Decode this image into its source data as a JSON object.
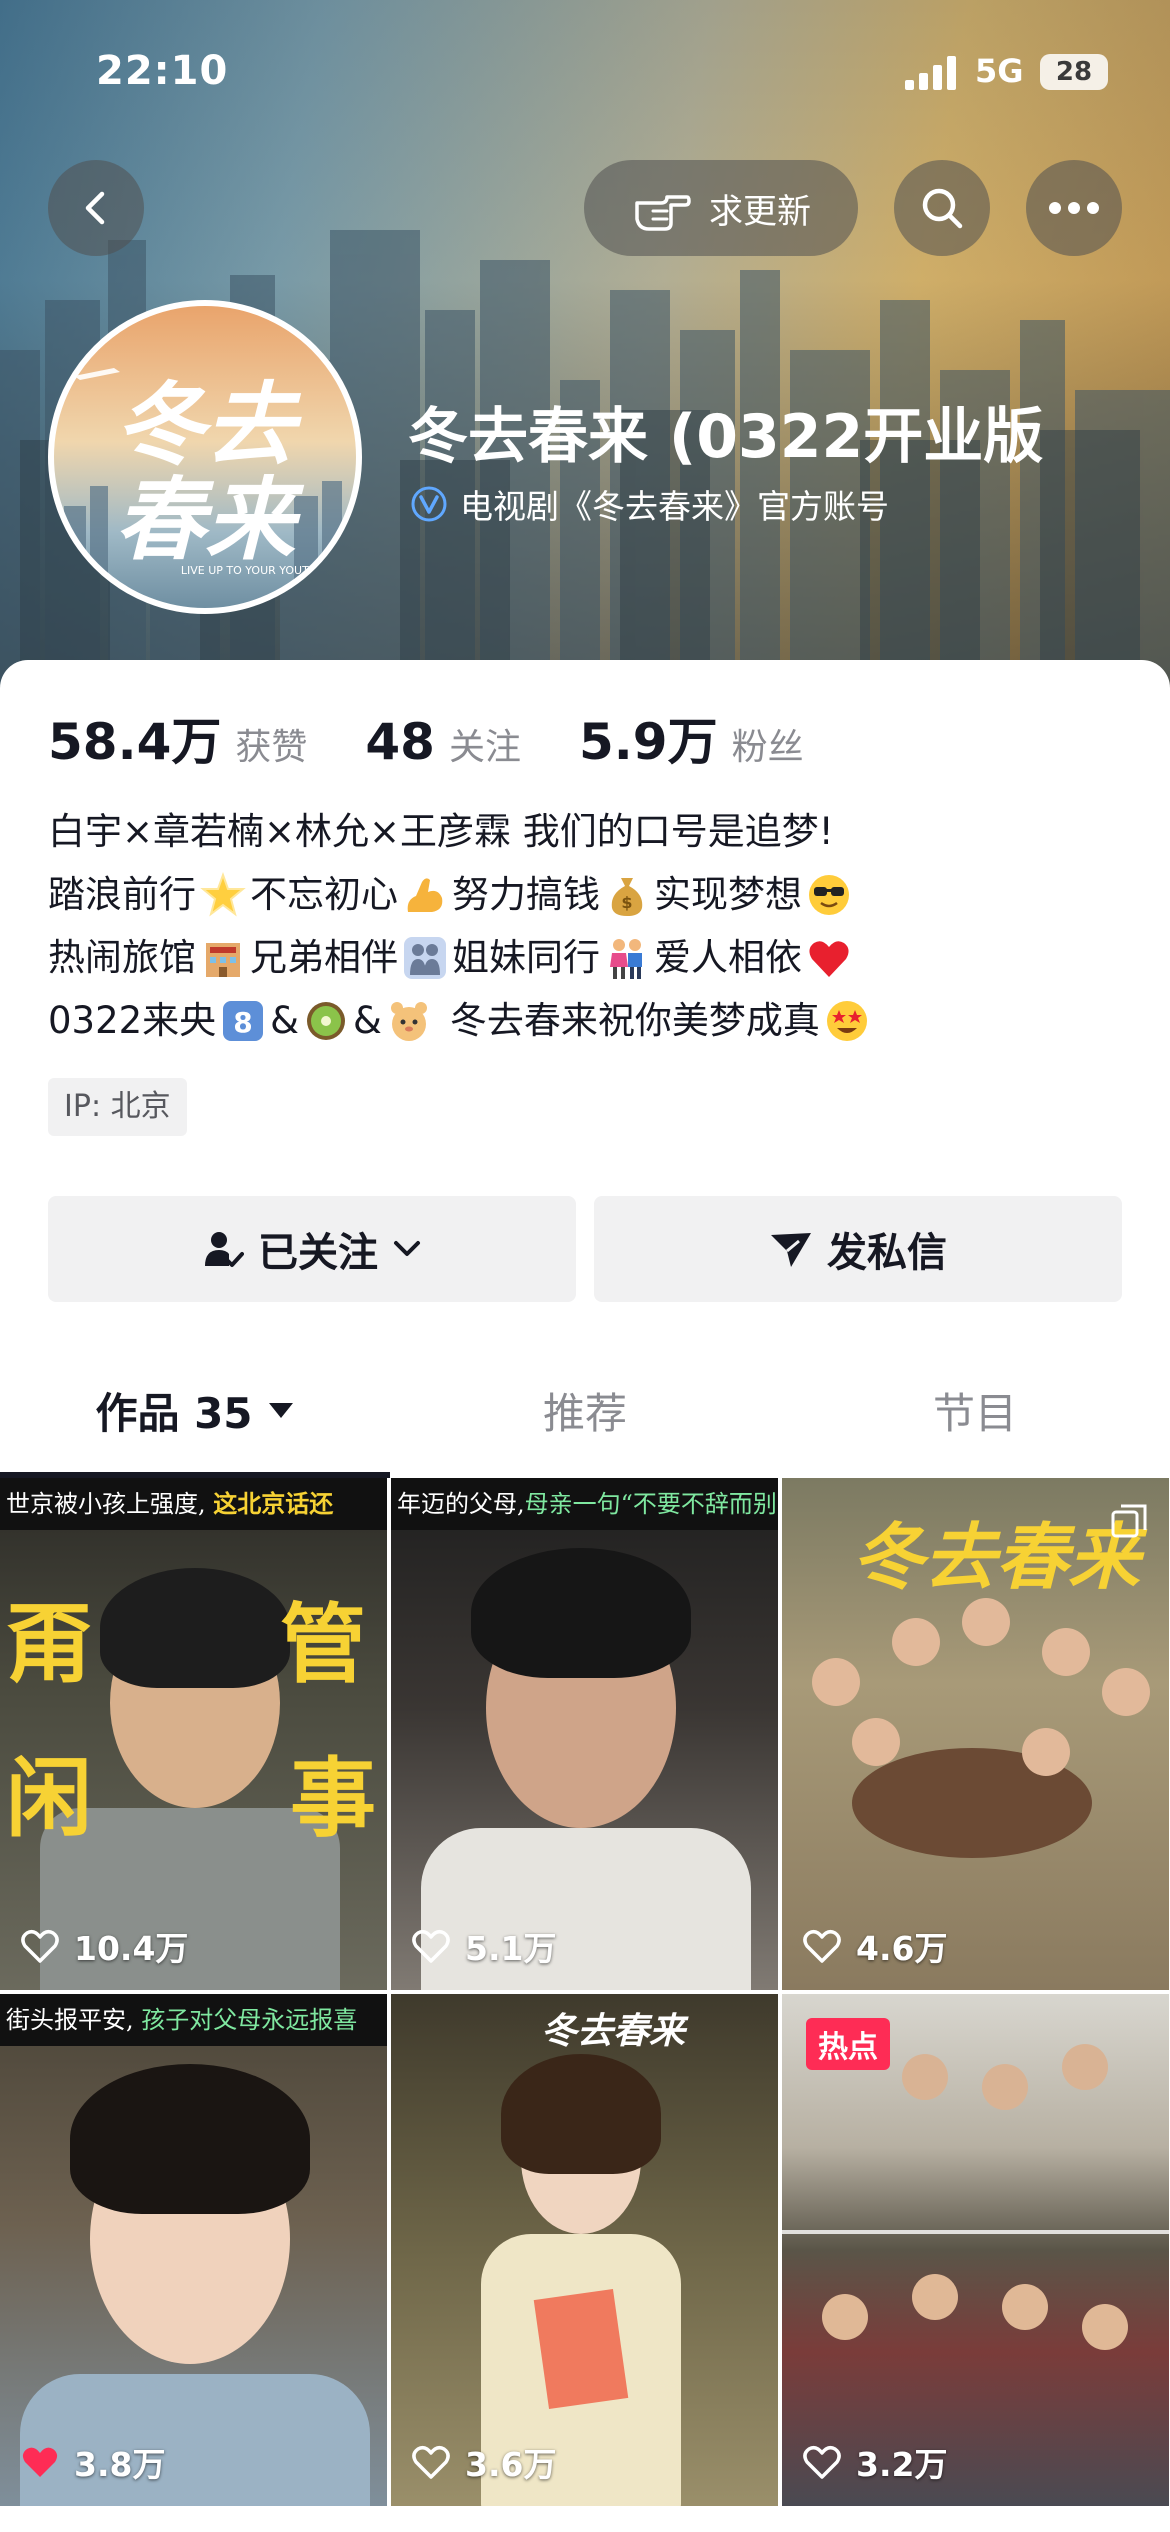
{
  "status_bar": {
    "time": "22:10",
    "network": "5G",
    "battery": "28"
  },
  "header": {
    "request_update_label": "求更新",
    "profile_name": "冬去春来 (0322开业版",
    "verification_text": "电视剧《冬去春来》官方账号",
    "avatar_title": "冬去春来",
    "avatar_subtitle": "LIVE UP TO YOUR YOUTH"
  },
  "stats": [
    {
      "value": "58.4万",
      "label": "获赞"
    },
    {
      "value": "48",
      "label": "关注"
    },
    {
      "value": "5.9万",
      "label": "粉丝"
    }
  ],
  "bio": {
    "line1": "白宇×章若楠×林允×王彦霖 我们的口号是追梦!",
    "line2_parts": [
      "踏浪前行",
      "不忘初心",
      "努力搞钱",
      "实现梦想"
    ],
    "line3_parts": [
      "热闹旅馆",
      "兄弟相伴",
      "姐妹同行",
      "爱人相依"
    ],
    "line4_prefix": "0322来央",
    "line4_amp": "&",
    "line4_suffix": "冬去春来祝你美梦成真"
  },
  "ip_label": "IP: 北京",
  "actions": {
    "follow_label": "已关注",
    "message_label": "发私信"
  },
  "tabs": [
    {
      "label": "作品 35",
      "active": true
    },
    {
      "label": "推荐",
      "active": false
    },
    {
      "label": "节目",
      "active": false
    }
  ],
  "videos": [
    {
      "likes": "10.4万",
      "banner_white": "世京被小孩上强度,",
      "banner_yellow": "这北京话还",
      "chars": [
        "甭",
        "管",
        "闲",
        "事"
      ]
    },
    {
      "likes": "5.1万",
      "banner_white": "年迈的父母,",
      "banner_green": "母亲一句“不要不辞而别”"
    },
    {
      "likes": "4.6万",
      "poster_title": "冬去春来"
    },
    {
      "likes": "3.8万",
      "banner_white": "街头报平安,",
      "banner_green": "孩子对父母永远报喜",
      "liked": true
    },
    {
      "likes": "3.6万",
      "poster_title": "冬去春来"
    },
    {
      "likes": "3.2万",
      "hot_label": "热点"
    }
  ],
  "colors": {
    "accent_red": "#fe2c55",
    "text_primary": "#161823",
    "text_secondary": "#8a8b91",
    "button_bg": "#f1f1f2"
  }
}
